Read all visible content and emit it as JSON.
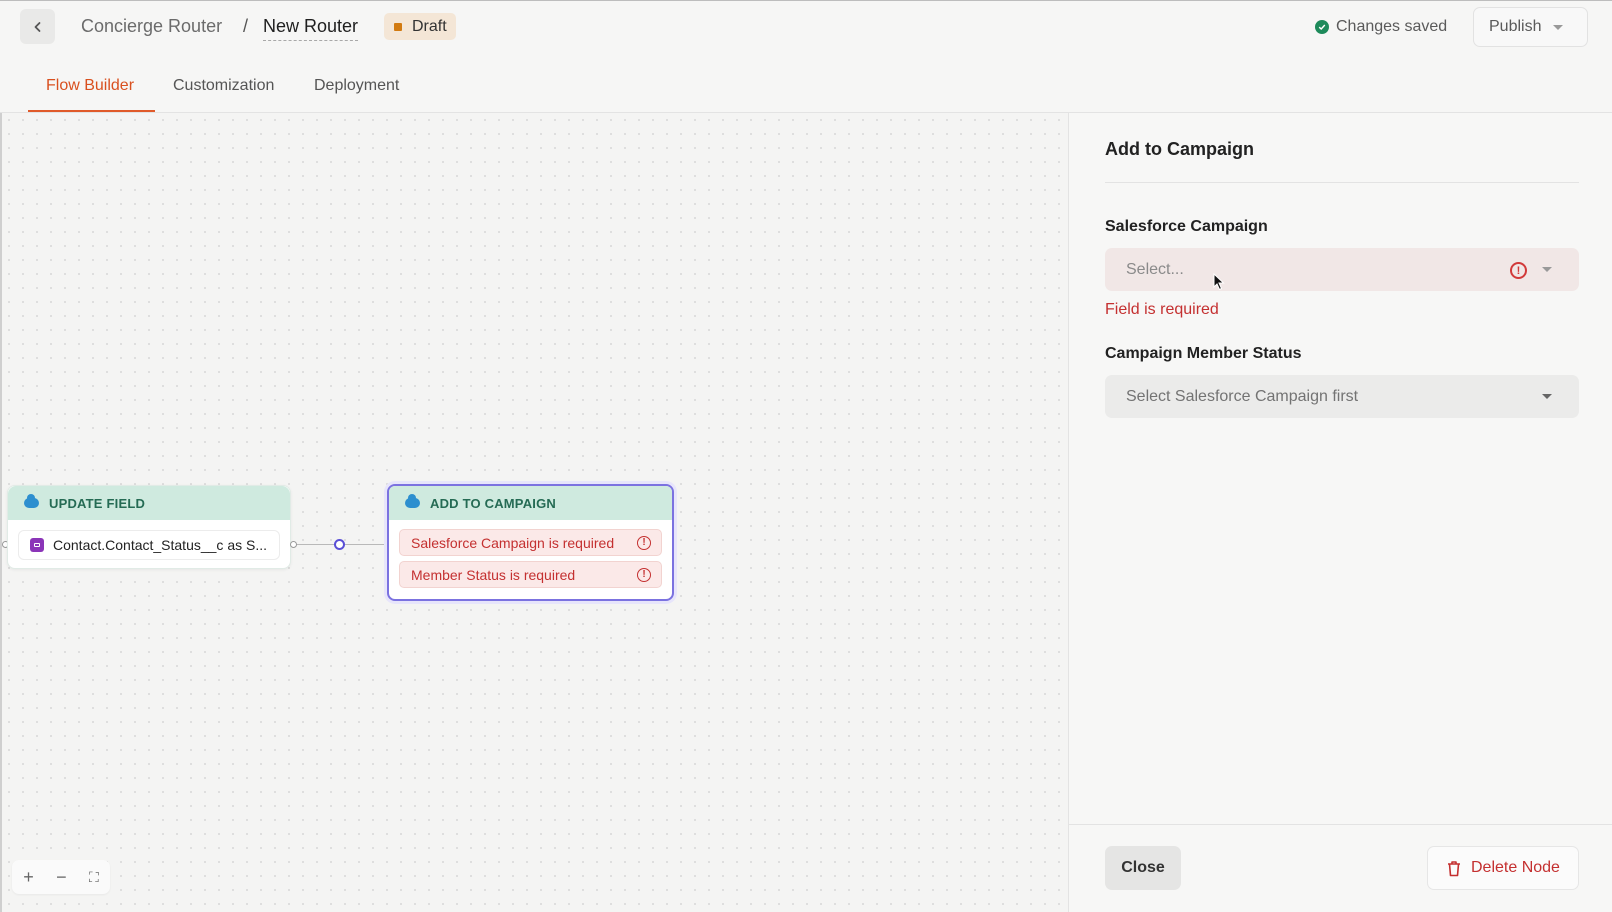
{
  "header": {
    "breadcrumb_parent": "Concierge Router",
    "breadcrumb_separator": "/",
    "breadcrumb_current": "New Router",
    "status_badge": "Draft",
    "save_status": "Changes saved",
    "publish_label": "Publish"
  },
  "tabs": [
    {
      "label": "Flow Builder",
      "active": true
    },
    {
      "label": "Customization",
      "active": false
    },
    {
      "label": "Deployment",
      "active": false
    }
  ],
  "canvas": {
    "nodes": [
      {
        "title": "UPDATE FIELD",
        "fields": [
          "Contact.Contact_Status__c as S..."
        ]
      },
      {
        "title": "ADD TO CAMPAIGN",
        "errors": [
          "Salesforce Campaign is required",
          "Member Status is required"
        ]
      }
    ],
    "zoom_controls": {
      "zoom_in": "+",
      "zoom_out": "−",
      "fit": "⛶"
    }
  },
  "panel": {
    "title": "Add to Campaign",
    "campaign_label": "Salesforce Campaign",
    "campaign_placeholder": "Select...",
    "campaign_error": "Field is required",
    "member_status_label": "Campaign Member Status",
    "member_status_placeholder": "Select Salesforce Campaign first",
    "close_label": "Close",
    "delete_label": "Delete Node"
  },
  "colors": {
    "accent": "#e05a2a",
    "error": "#c43030",
    "node_header": "#cfeadf",
    "selected_node_border": "#7b72e0",
    "saved_icon": "#1d8a5a"
  }
}
